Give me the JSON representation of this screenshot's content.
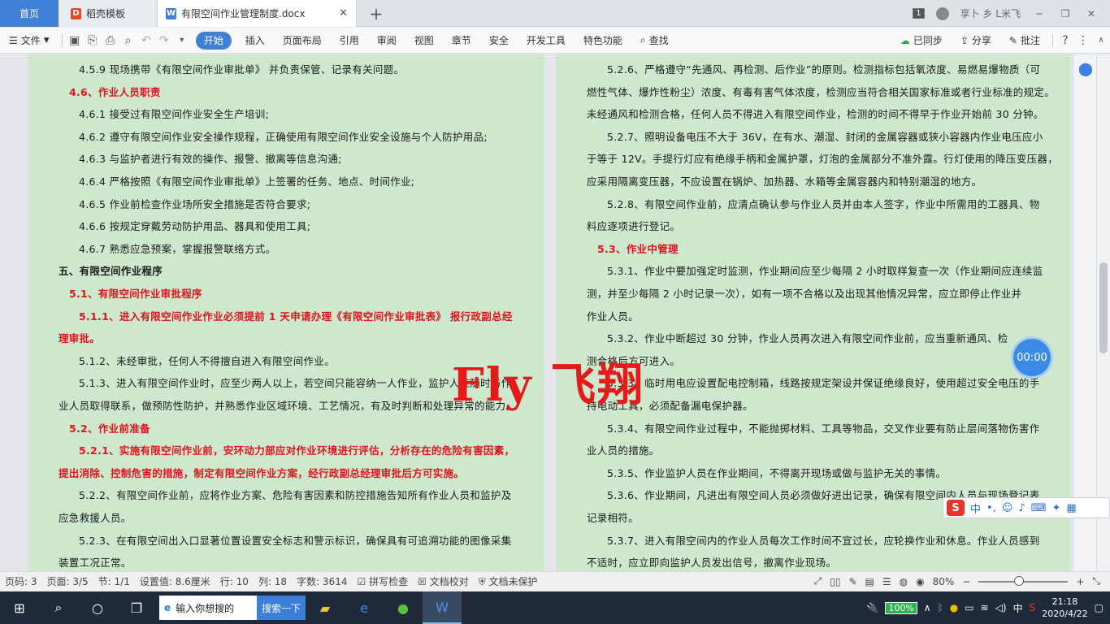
{
  "tabs": {
    "home": "首页",
    "template": "稻壳模板",
    "document": "有限空间作业管理制度.docx",
    "add": "+",
    "close": "✕"
  },
  "title_right": {
    "badge": "1",
    "user": "享卜 乡 L米飞",
    "min": "─",
    "restore": "❐",
    "close": "✕"
  },
  "menubar": {
    "file": "文件",
    "items": [
      "开始",
      "插入",
      "页面布局",
      "引用",
      "审阅",
      "视图",
      "章节",
      "安全",
      "开发工具",
      "特色功能"
    ],
    "search": "查找",
    "synced": "已同步",
    "share": "分享",
    "comment": "批注"
  },
  "doc_left": [
    {
      "text": "4.5.9 现场携带《有限空间作业审批单》 并负责保管、记录有关问题。",
      "style": "normal"
    },
    {
      "text": "4.6、作业人员职责",
      "style": "red"
    },
    {
      "text": "4.6.1 接受过有限空间作业安全生产培训;",
      "style": "normal"
    },
    {
      "text": "4.6.2 遵守有限空间作业安全操作规程，正确使用有限空间作业安全设施与个人防护用品;",
      "style": "normal"
    },
    {
      "text": "4.6.3 与监护者进行有效的操作、报警、撤离等信息沟通;",
      "style": "normal"
    },
    {
      "text": "4.6.4 严格按照《有限空间作业审批单》上签署的任务、地点、时间作业;",
      "style": "normal"
    },
    {
      "text": "4.6.5 作业前检查作业场所安全措施是否符合要求;",
      "style": "normal"
    },
    {
      "text": "4.6.6 按规定穿戴劳动防护用品、器具和使用工具;",
      "style": "normal"
    },
    {
      "text": "4.6.7 熟悉应急预案，掌握报警联络方式。",
      "style": "normal"
    },
    {
      "text": "五、有限空间作业程序",
      "style": "bold"
    },
    {
      "text": "5.1、有限空间作业审批程序",
      "style": "red"
    },
    {
      "text": "5.1.1、进入有限空间作业作业必须提前 1 天申请办理《有限空间作业审批表》 报行政副总经",
      "style": "red"
    },
    {
      "text": "理审批。",
      "style": "red"
    },
    {
      "text": "5.1.2、未经审批，任何人不得擅自进入有限空间作业。",
      "style": "normal"
    },
    {
      "text": "5.1.3、进入有限空间作业时，应至少两人以上，若空间只能容纳一人作业，监护人应随时与作",
      "style": "normal"
    },
    {
      "text": "业人员取得联系，做预防性防护，并熟悉作业区域环境、工艺情况，有及时判断和处理异常的能力。",
      "style": "normal"
    },
    {
      "text": "5.2、作业前准备",
      "style": "red"
    },
    {
      "text": "5.2.1、实施有限空间作业前，安环动力部应对作业环境进行评估，分析存在的危险有害因素，",
      "style": "red"
    },
    {
      "text": "提出消除、控制危害的措施，制定有限空间作业方案，经行政副总经理审批后方可实施。",
      "style": "red"
    },
    {
      "text": "5.2.2、有限空间作业前，应将作业方案、危险有害因素和防控措施告知所有作业人员和监护及",
      "style": "normal"
    },
    {
      "text": "应急救援人员。",
      "style": "normal"
    },
    {
      "text": "5.2.3、在有限空间出入口显著位置设置安全标志和警示标识，确保具有可追溯功能的图像采集",
      "style": "normal"
    },
    {
      "text": "装置工况正常。",
      "style": "normal"
    }
  ],
  "doc_right": [
    {
      "text": "5.2.6、严格遵守“先通风、再检测、后作业”的原则。检测指标包括氧浓度、易燃易爆物质（可",
      "style": "normal"
    },
    {
      "text": "燃性气体、爆炸性粉尘）浓度、有毒有害气体浓度，检测应当符合相关国家标准或者行业标准的规定。",
      "style": "normal"
    },
    {
      "text": "未经通风和检测合格，任何人员不得进入有限空间作业，检测的时间不得早于作业开始前 30 分钟。",
      "style": "normal"
    },
    {
      "text": "5.2.7、照明设备电压不大于 36V，在有水、潮湿、封闭的金属容器或狭小容器内作业电压应小",
      "style": "normal"
    },
    {
      "text": "于等于 12V。手提行灯应有绝缘手柄和金属护罩，灯泡的金属部分不准外露。行灯使用的降压变压器，",
      "style": "normal"
    },
    {
      "text": "应采用隔离变压器，不应设置在锅炉、加热器、水箱等金属容器内和特别潮湿的地方。",
      "style": "normal"
    },
    {
      "text": "5.2.8、有限空间作业前，应清点确认参与作业人员并由本人签字，作业中所需用的工器具、物",
      "style": "normal"
    },
    {
      "text": "料应逐项进行登记。",
      "style": "normal"
    },
    {
      "text": "5.3、作业中管理",
      "style": "red"
    },
    {
      "text": "5.3.1、作业中要加强定时监测，作业期间应至少每隔 2 小时取样复查一次（作业期间应连续监",
      "style": "normal"
    },
    {
      "text": "测，并至少每隔 2 小时记录一次），如有一项不合格以及出现其他情况异常，应立即停止作业并",
      "style": "normal"
    },
    {
      "text": "作业人员。",
      "style": "normal"
    },
    {
      "text": "5.3.2、作业中断超过 30 分钟，作业人员再次进入有限空间作业前，应当重新通风、检",
      "style": "normal"
    },
    {
      "text": "测合格后方可进入。",
      "style": "normal"
    },
    {
      "text": "5.3.3、临时用电应设置配电控制箱，线路按规定架设并保证绝缘良好，使用超过安全电压的手",
      "style": "normal"
    },
    {
      "text": "持电动工具，必须配备漏电保护器。",
      "style": "normal"
    },
    {
      "text": "5.3.4、有限空间作业过程中，不能抛掷材料、工具等物品，交叉作业要有防止层间落物伤害作",
      "style": "normal"
    },
    {
      "text": "业人员的措施。",
      "style": "normal"
    },
    {
      "text": "5.3.5、作业监护人员在作业期间，不得离开现场或做与监护无关的事情。",
      "style": "normal"
    },
    {
      "text": "5.3.6、作业期间，凡进出有限空间人员必须做好进出记录，确保有限空间内人员与现场登记表",
      "style": "normal"
    },
    {
      "text": "记录相符。",
      "style": "normal"
    },
    {
      "text": "5.3.7、进入有限空间内的作业人员每次工作时间不宜过长，应轮换作业和休息。作业人员感到",
      "style": "normal"
    },
    {
      "text": "不适时，应立即向监护人员发出信号，撤离作业现场。",
      "style": "normal"
    }
  ],
  "watermark": "Fly 飞翔",
  "timer": "00:00",
  "sogou": {
    "logo": "S",
    "lang": "中"
  },
  "status": {
    "page_num": "页码: 3",
    "pages": "页面: 3/5",
    "section": "节: 1/1",
    "setting": "设置值: 8.6厘米",
    "row": "行: 10",
    "col": "列: 18",
    "words": "字数: 3614",
    "spell": "拼写检查",
    "proof": "文档校对",
    "protect": "文档未保护",
    "zoom": "80%",
    "zoom_level": 0.8
  },
  "taskbar": {
    "search_placeholder": "输入你想搜的",
    "search_button": "搜索一下",
    "battery": "100%",
    "ime": "中",
    "time": "21:18",
    "date": "2020/4/22"
  }
}
